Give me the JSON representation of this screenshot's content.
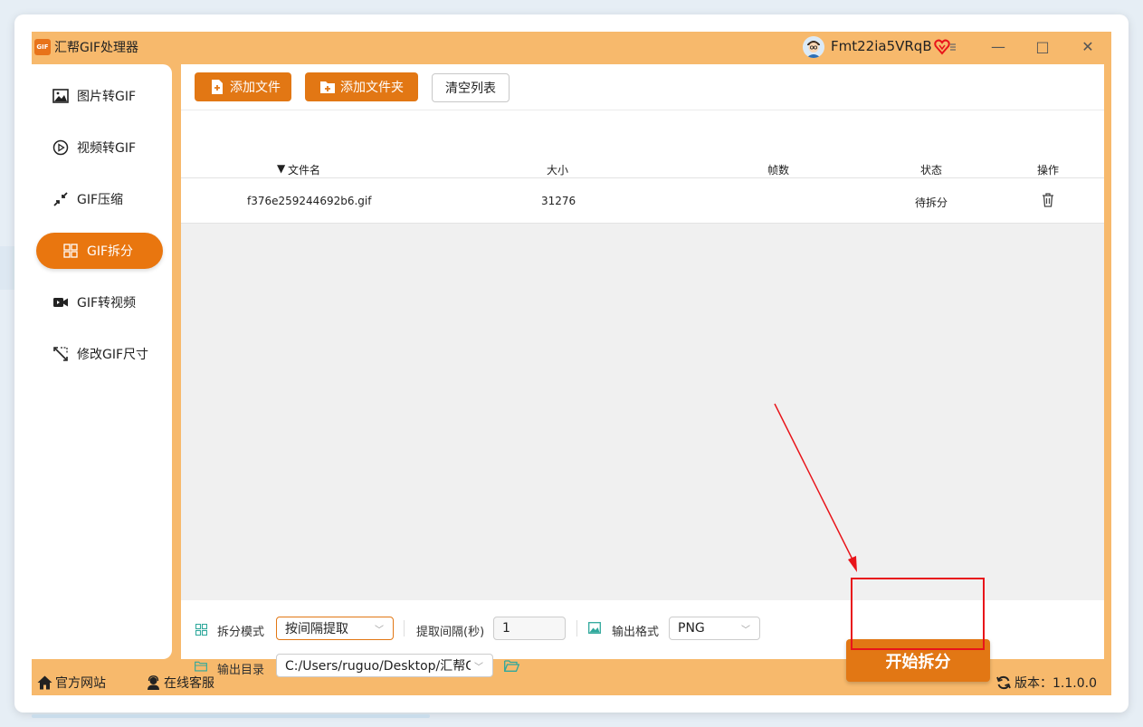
{
  "app": {
    "title": "汇帮GIF处理器",
    "logo_text": "GIF",
    "accent": "#e27714",
    "frame_color": "#f7b96c"
  },
  "user": {
    "name": "Fmt22ia5VRqB"
  },
  "window_controls": {
    "menu": "≡",
    "minimize": "—",
    "maximize": "□",
    "close": "✕"
  },
  "sidebar": {
    "items": [
      {
        "label": "图片转GIF",
        "icon": "image-icon",
        "active": false
      },
      {
        "label": "视频转GIF",
        "icon": "play-circle-icon",
        "active": false
      },
      {
        "label": "GIF压缩",
        "icon": "compress-arrows-icon",
        "active": false
      },
      {
        "label": "GIF拆分",
        "icon": "grid-split-icon",
        "active": true
      },
      {
        "label": "GIF转视频",
        "icon": "video-camera-icon",
        "active": false
      },
      {
        "label": "修改GIF尺寸",
        "icon": "resize-icon",
        "active": false
      }
    ]
  },
  "toolbar": {
    "add_file": "添加文件",
    "add_folder": "添加文件夹",
    "clear_list": "清空列表"
  },
  "table": {
    "columns": {
      "filename": "文件名",
      "size": "大小",
      "frames": "帧数",
      "status": "状态",
      "actions": "操作"
    },
    "rows": [
      {
        "filename": "f376e259244692b6.gif",
        "size": "31276",
        "frames": "",
        "status": "待拆分"
      }
    ]
  },
  "settings": {
    "split_mode_label": "拆分模式",
    "split_mode_value": "按间隔提取",
    "interval_label": "提取间隔(秒)",
    "interval_value": "1",
    "format_label": "输出格式",
    "format_value": "PNG",
    "output_dir_label": "输出目录",
    "output_dir_value": "C:/Users/ruguo/Desktop/汇帮GIF"
  },
  "start_button": "开始拆分",
  "footer": {
    "website": "官方网站",
    "support": "在线客服",
    "version": "版本：1.1.0.0"
  },
  "annotation_color": "#e8141a"
}
